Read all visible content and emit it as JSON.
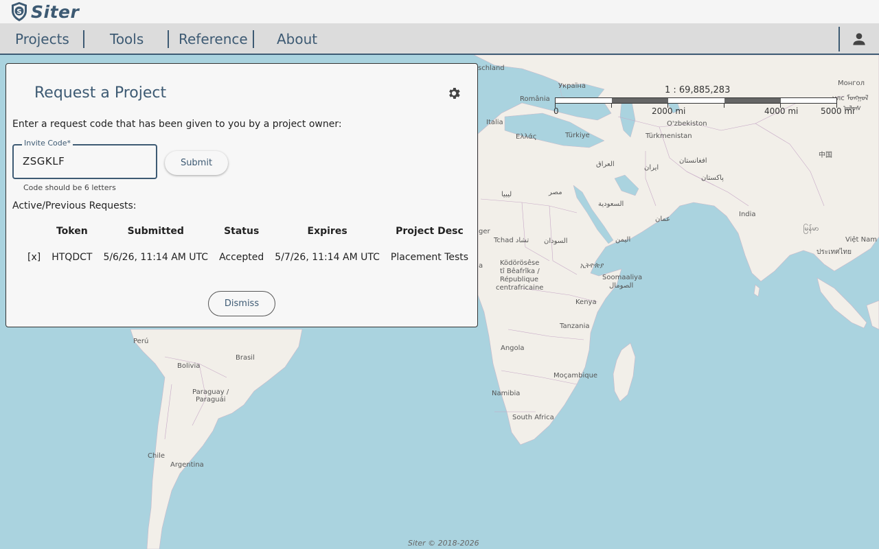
{
  "app": {
    "name": "Siter"
  },
  "nav": {
    "items": [
      "Projects",
      "Tools",
      "Reference",
      "About"
    ]
  },
  "map": {
    "scale_ratio": "1 : 69,885,283",
    "scale_ticks": [
      "0",
      "2000 mi",
      "4000 mi",
      "5000 mi"
    ],
    "labels": [
      "schland",
      "Україна",
      "România",
      "Italia",
      "Ελλάς",
      "Türkiye",
      "O'zbekiston",
      "Türkmenistan",
      "Монгол",
      "улс ᠮᠣᠩᠭᠣᠯ",
      "ᠤᠯᠤᠰ",
      "中国",
      "العراق",
      "ایران",
      "افغانستان",
      "پاکستان",
      "India",
      "ليبيا",
      "مصر",
      "السعودية",
      "عمان",
      "ger",
      "Tchad تشاد",
      "السودان",
      "اليمن",
      "ኢትዮጵያ",
      "Soomaaliya",
      "الصومال",
      "Kenya",
      "Tanzania",
      "Angola",
      "Moçambique",
      "Namibia",
      "South Africa",
      "Perú",
      "Brasil",
      "Bolivia",
      "Paraguay /",
      "Paraguái",
      "Chile",
      "Argentina",
      "Việt Nam",
      "ประเทศไทย",
      "မြန်မာ",
      "Ködörösêse",
      "tî Bêafrîka /",
      "République",
      "centrafricaine",
      "a"
    ]
  },
  "dialog": {
    "title": "Request a Project",
    "instructions": "Enter a request code that has been given to you by a project owner:",
    "invite_label": "Invite Code",
    "required_mark": "*",
    "invite_value": "ZSGKLF",
    "hint": "Code should be 6 letters",
    "submit_label": "Submit",
    "requests_title": "Active/Previous Requests:",
    "table": {
      "headers": [
        "",
        "Token",
        "Submitted",
        "Status",
        "Expires",
        "Project Desc"
      ],
      "rows": [
        [
          "[x]",
          "HTQDCT",
          "5/6/26, 11:14 AM UTC",
          "Accepted",
          "5/7/26, 11:14 AM UTC",
          "Placement Tests"
        ]
      ]
    },
    "dismiss_label": "Dismiss"
  },
  "footer": "Siter © 2018-2026",
  "colors": {
    "brand": "#3d5a73",
    "water": "#aad3df",
    "land": "#f2efe9"
  }
}
